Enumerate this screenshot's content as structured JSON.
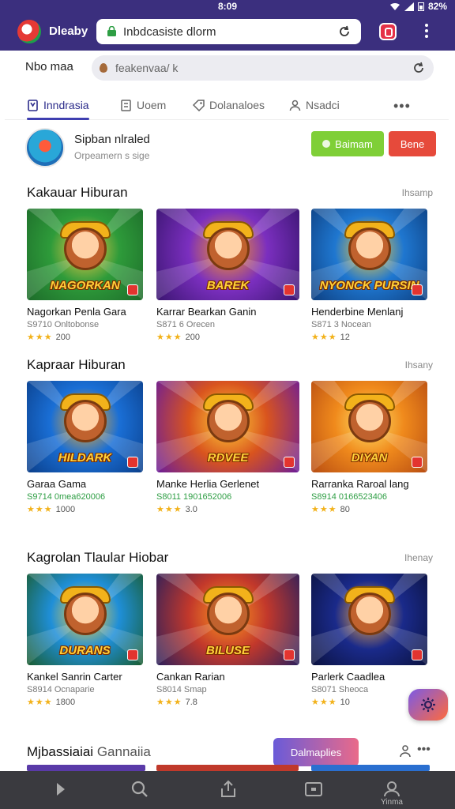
{
  "status_bar": {
    "time": "8:09",
    "battery": "82%"
  },
  "browser": {
    "brand": "Dleaby",
    "url": "Inbdcasiste dlorm"
  },
  "page": {
    "site_title": "Nbo maa",
    "search": {
      "value": "feakenvaa/ k"
    }
  },
  "tabs": [
    {
      "label": "Inndrasia",
      "icon": "bookmark-icon"
    },
    {
      "label": "Uoem",
      "icon": "document-icon"
    },
    {
      "label": "Dolanaloes",
      "icon": "tag-icon"
    },
    {
      "label": "Nsadci",
      "icon": "person-icon"
    }
  ],
  "profile": {
    "name": "Sipban nlraled",
    "subtitle": "Orpeamern s sige",
    "primary_button": "Baimam",
    "secondary_button": "Bene"
  },
  "sections": [
    {
      "title": "Kakauar Hiburan",
      "more": "Ihsamp",
      "cards": [
        {
          "name": "Nagorkan Penla Gara",
          "meta": "S9710 Onltobonse",
          "rating": "200",
          "logo": "NAGORKAN",
          "colors": [
            "#2e9b3a",
            "#f7c948",
            "#1d6b2a"
          ]
        },
        {
          "name": "Karrar Bearkan Ganin",
          "meta": "S871 6 Orecen",
          "rating": "200",
          "logo": "BAREK",
          "colors": [
            "#7b2fbf",
            "#ff9a1f",
            "#3a1570"
          ]
        },
        {
          "name": "Henderbine Menlanj",
          "meta": "S871 3 Nocean",
          "rating": "12",
          "logo": "NYONCK PURSIN",
          "colors": [
            "#1f77d0",
            "#ffd23a",
            "#0d3f80"
          ]
        }
      ]
    },
    {
      "title": "Kapraar Hiburan",
      "more": "Ihsany",
      "cards": [
        {
          "name": "Garaa Gama",
          "meta": "S9714 0mea620006",
          "rating": "1000",
          "logo": "HILDARK",
          "colors": [
            "#1a6fd6",
            "#ffb020",
            "#0b3f8a"
          ],
          "green": true
        },
        {
          "name": "Manke Herlia Gerlenet",
          "meta": "S8011 1901652006",
          "rating": "3.0",
          "logo": "RDVEE",
          "colors": [
            "#d9541e",
            "#ffd23a",
            "#6a1c9a"
          ],
          "green": true
        },
        {
          "name": "Rarranka Raroal lang",
          "meta": "S8914 0166523406",
          "rating": "80",
          "logo": "DIYAN",
          "colors": [
            "#f08a1c",
            "#ffe36a",
            "#b84d12"
          ],
          "green": true
        }
      ]
    },
    {
      "title": "Kagrolan Tlaular Hiobar",
      "more": "Ihenay",
      "cards": [
        {
          "name": "Kankel Sanrin Carter",
          "meta": "S8914 Ocnaparie",
          "rating": "1800",
          "logo": "DURANS",
          "colors": [
            "#1f8fd8",
            "#ffd23a",
            "#1a5c2e"
          ]
        },
        {
          "name": "Cankan Rarian",
          "meta": "S8014 Smap",
          "rating": "7.8",
          "logo": "BILUSE",
          "colors": [
            "#c2382b",
            "#ff9a1f",
            "#2a1f5c"
          ]
        },
        {
          "name": "Parlerk Caadlea",
          "meta": "S8071 Sheoca",
          "rating": "10",
          "logo": "",
          "colors": [
            "#1a2a8a",
            "#ffb347",
            "#0b123f"
          ]
        }
      ]
    }
  ],
  "bottom": {
    "title_main": "Mjbassiaiai",
    "title_light": "Gannaiia",
    "pill": "Dalmaplies"
  },
  "sysnav": {
    "label": "Yinma"
  }
}
